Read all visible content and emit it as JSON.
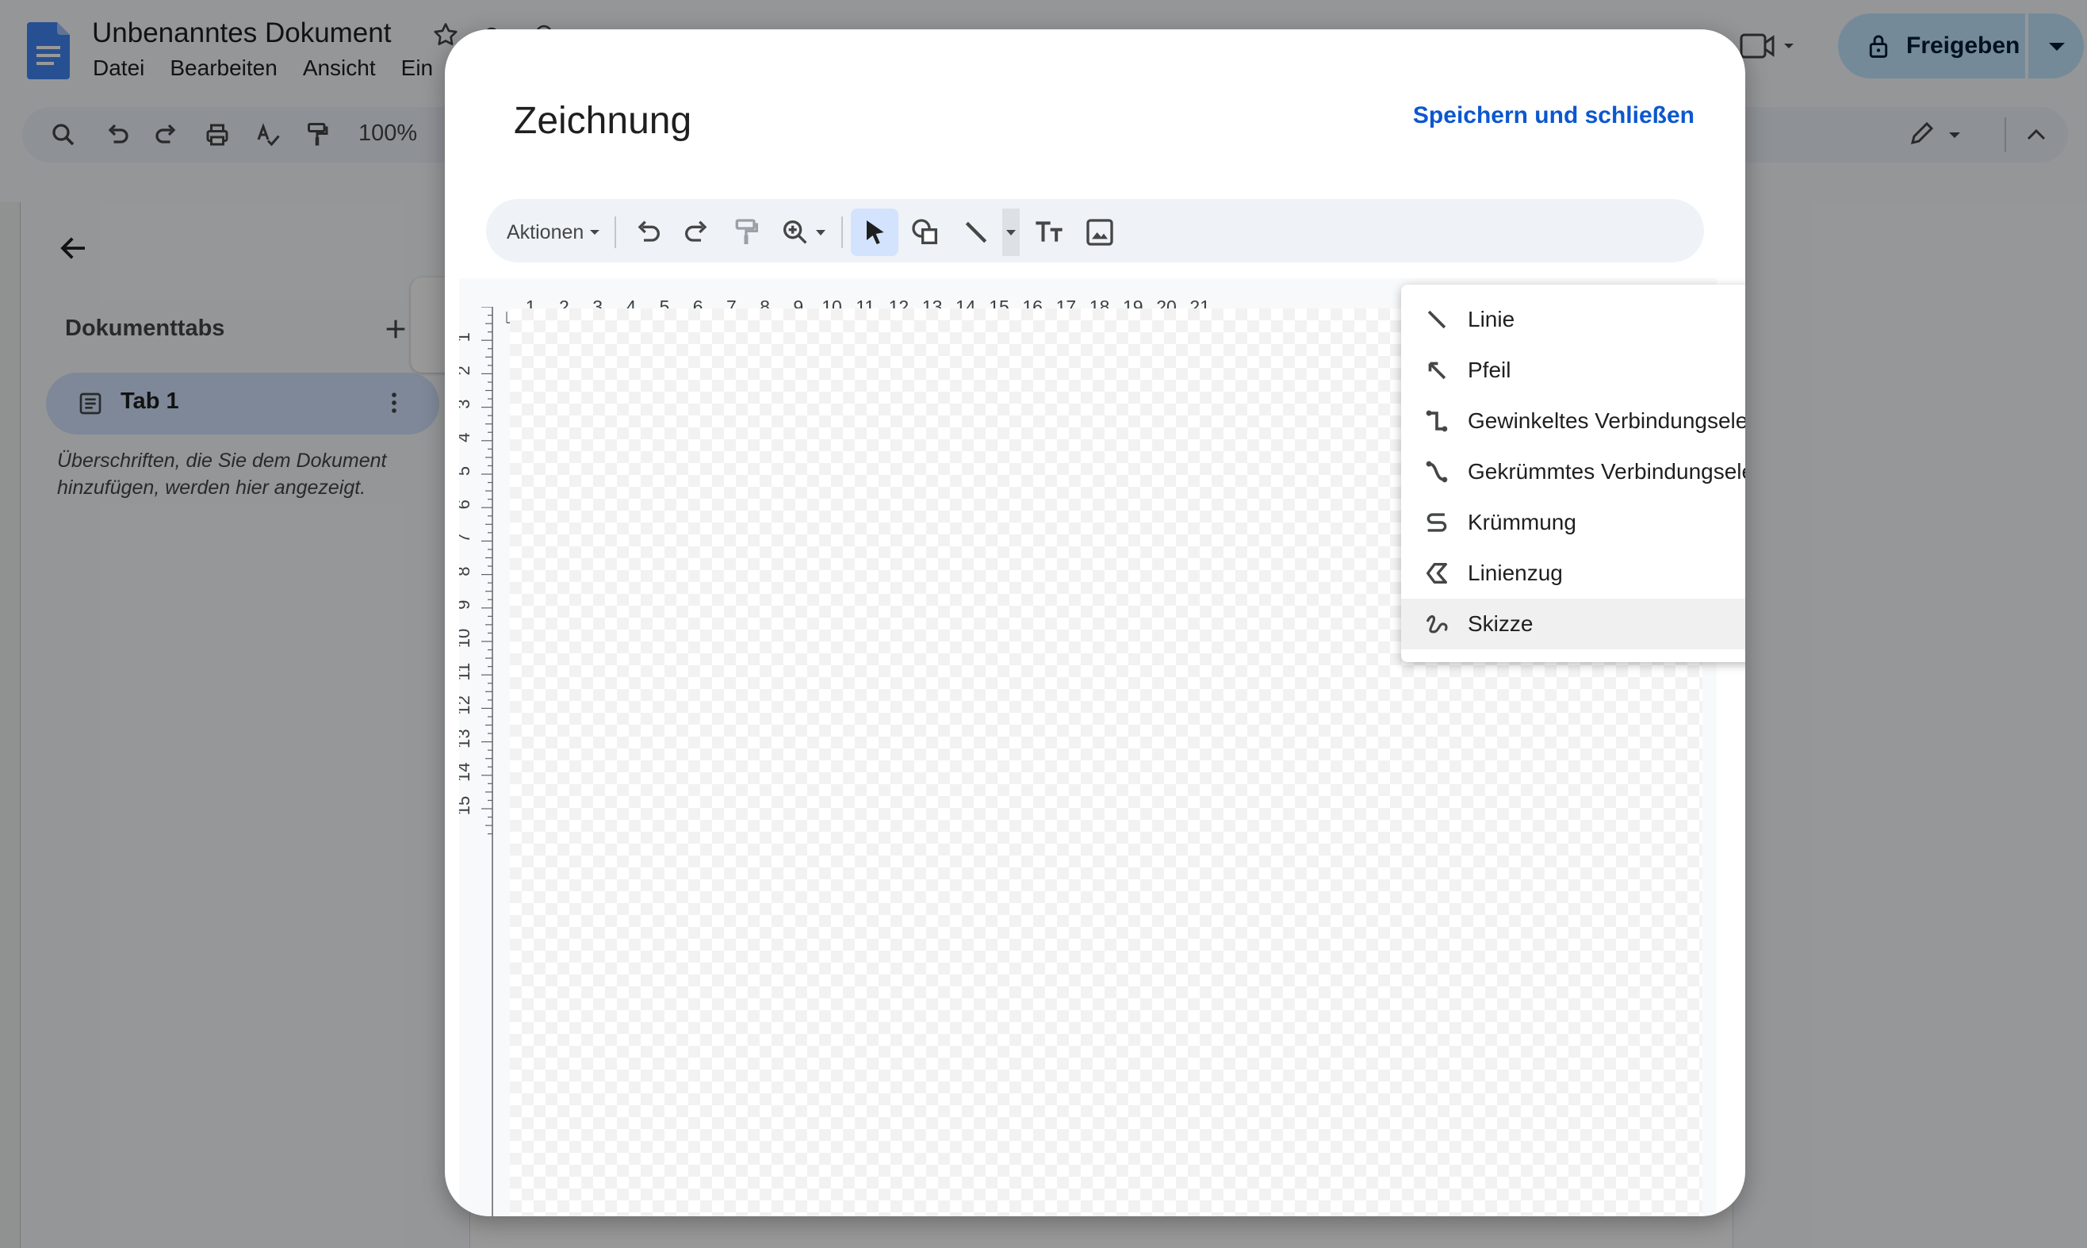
{
  "docs": {
    "title": "Unbenanntes Dokument",
    "menu": [
      "Datei",
      "Bearbeiten",
      "Ansicht",
      "Ein"
    ],
    "zoom": "100%",
    "share_label": "Freigeben",
    "sidebar": {
      "heading": "Dokumenttabs",
      "tab_label": "Tab 1",
      "outline_hint": "Überschriften, die Sie dem Dokument hinzufügen, werden hier angezeigt."
    }
  },
  "dialog": {
    "title": "Zeichnung",
    "save_close": "Speichern und schließen",
    "toolbar": {
      "actions_label": "Aktionen"
    },
    "ruler_h": [
      "1",
      "2",
      "3",
      "4",
      "5",
      "6",
      "7",
      "8",
      "9",
      "10",
      "11",
      "12",
      "13",
      "14",
      "15",
      "16",
      "17",
      "18",
      "19",
      "20",
      "21"
    ],
    "ruler_v": [
      "1",
      "2",
      "3",
      "4",
      "5",
      "6",
      "7",
      "8",
      "9",
      "10",
      "11",
      "12",
      "13",
      "14",
      "15"
    ],
    "line_menu": [
      {
        "label": "Linie",
        "icon": "line-icon"
      },
      {
        "label": "Pfeil",
        "icon": "arrow-icon"
      },
      {
        "label": "Gewinkeltes Verbindungselement",
        "icon": "elbow-connector-icon"
      },
      {
        "label": "Gekrümmtes Verbindungselement",
        "icon": "curved-connector-icon"
      },
      {
        "label": "Krümmung",
        "icon": "curve-icon"
      },
      {
        "label": "Linienzug",
        "icon": "polyline-icon"
      },
      {
        "label": "Skizze",
        "icon": "scribble-icon"
      }
    ],
    "highlighted_item": "Skizze"
  },
  "colors": {
    "accent": "#0b57d0",
    "share_bg": "#c2e7ff",
    "tab_bg": "#d3e3fd",
    "scrim": "rgba(0,0,0,0.40)"
  }
}
